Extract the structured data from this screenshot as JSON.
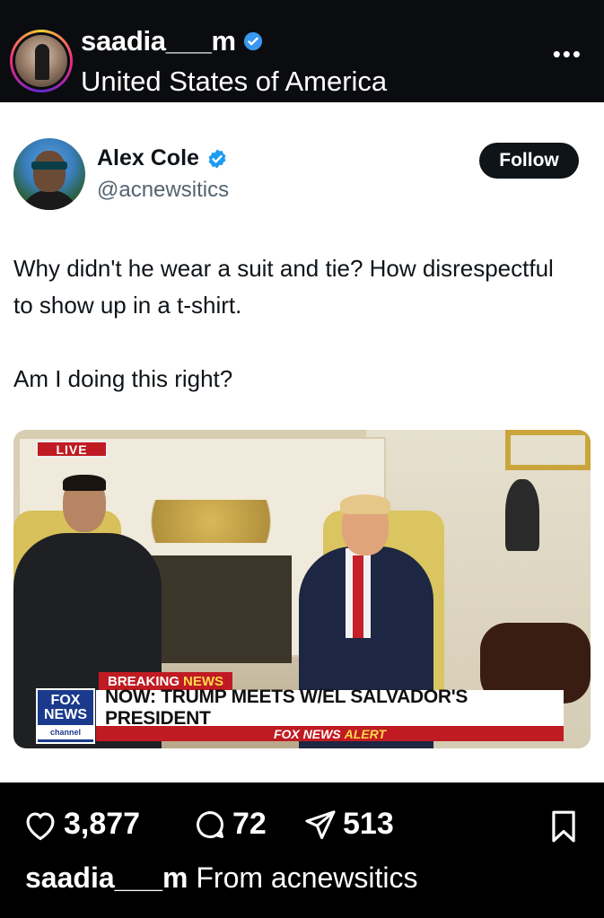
{
  "header": {
    "username": "saadia___m",
    "verified": true,
    "location": "United States of America"
  },
  "tweet": {
    "author_name": "Alex Cole",
    "author_handle": "@acnewsitics",
    "follow_label": "Follow",
    "text": [
      "Why didn't he wear a suit and tie? How disrespectful to show up in a t-shirt.",
      "Am I doing this right?"
    ],
    "media": {
      "live_label": "LIVE",
      "breaking_label": "BREAKING",
      "breaking_news_word": "NEWS",
      "headline": "NOW: TRUMP MEETS W/EL SALVADOR'S PRESIDENT",
      "network_logo_top": "FOX",
      "network_logo_mid": "NEWS",
      "network_logo_sub": "channel",
      "alert_prefix": "FOX NEWS",
      "alert_word": "ALERT"
    }
  },
  "actions": {
    "likes": "3,877",
    "comments": "72",
    "shares": "513"
  },
  "caption": {
    "username": "saadia___m",
    "text": "From acnewsitics"
  },
  "colors": {
    "verified_blue": "#1d9bf0",
    "follow_bg": "#0f1419",
    "fox_red": "#c01b22"
  }
}
